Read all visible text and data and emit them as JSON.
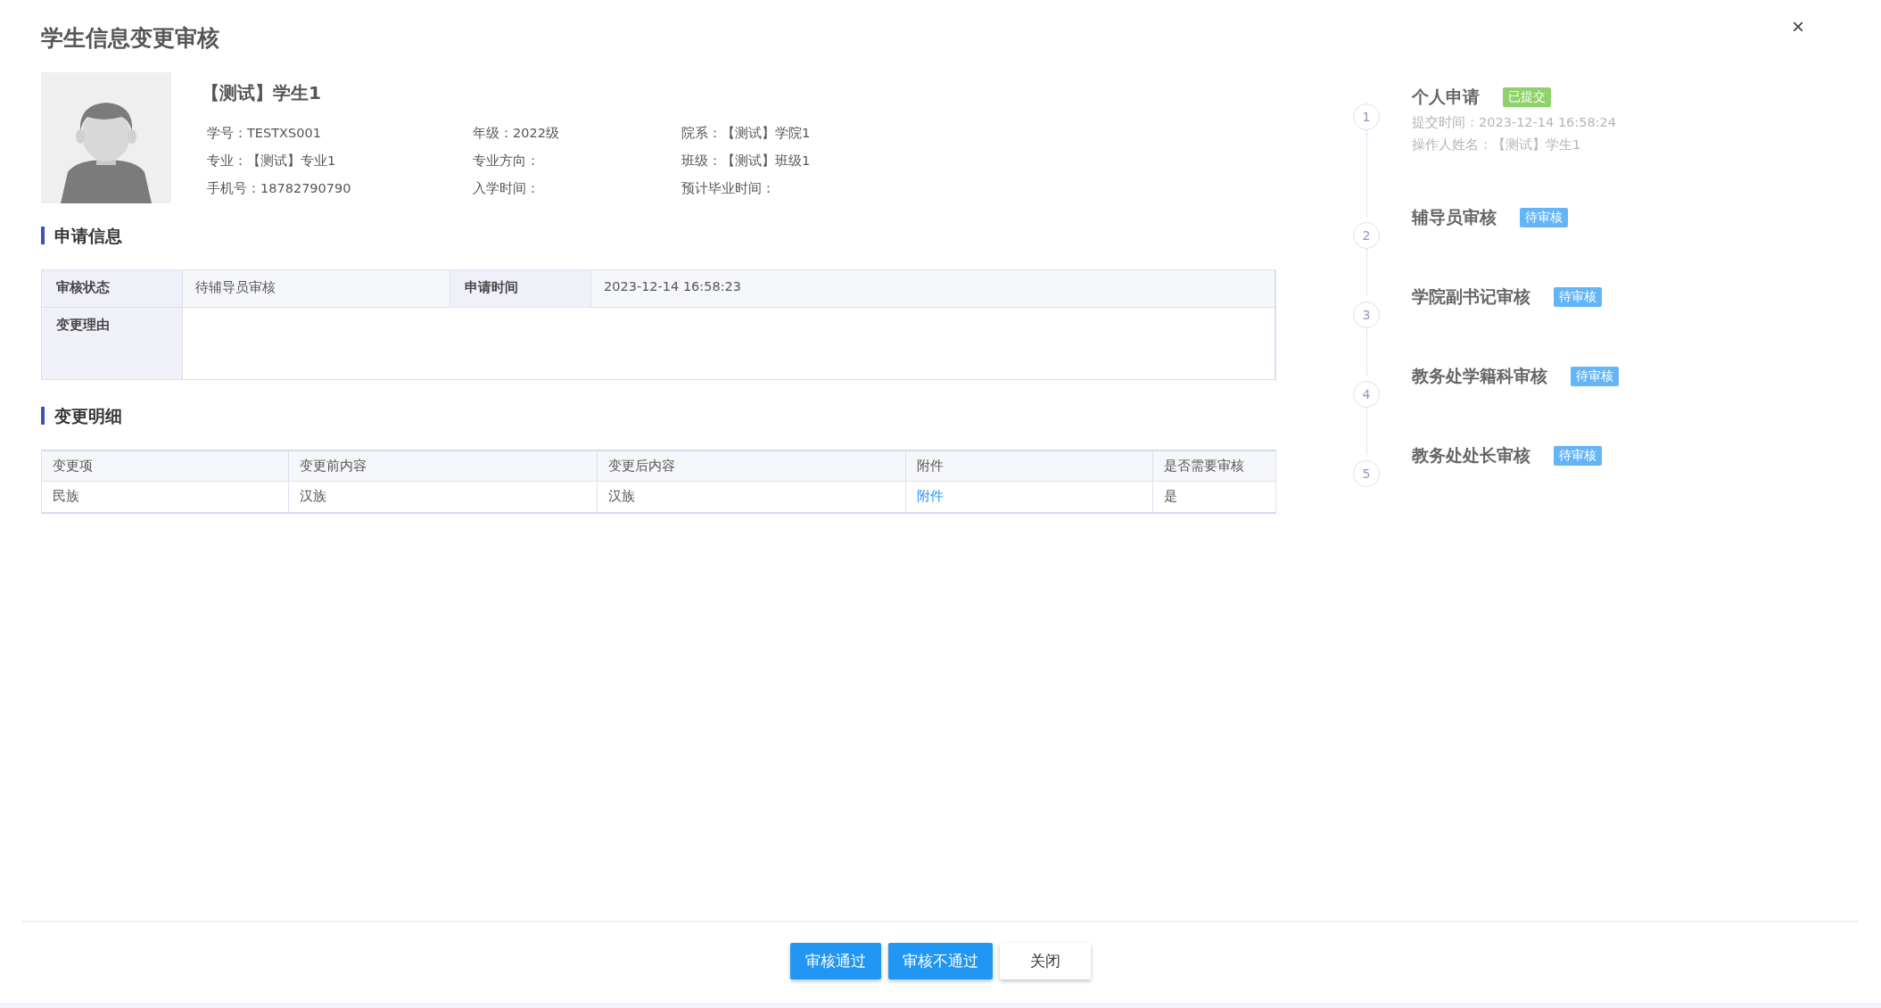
{
  "dialog": {
    "title": "学生信息变更审核",
    "close": "×"
  },
  "student": {
    "name": "【测试】学生1",
    "fields": [
      {
        "label": "学号：",
        "value": "TESTXS001"
      },
      {
        "label": "年级：",
        "value": "2022级"
      },
      {
        "label": "院系：",
        "value": "【测试】学院1"
      },
      {
        "label": "专业：",
        "value": "【测试】专业1"
      },
      {
        "label": "专业方向："
      },
      {
        "label": "班级：",
        "value": "【测试】班级1"
      },
      {
        "label": "手机号：",
        "value": "18782790790"
      },
      {
        "label": "入学时间："
      },
      {
        "label": "预计毕业时间："
      }
    ]
  },
  "application": {
    "heading": "申请信息",
    "status_label": "审核状态",
    "status_value": "待辅导员审核",
    "time_label": "申请时间",
    "time_value": "2023-12-14 16:58:23",
    "reason_label": "变更理由"
  },
  "changes": {
    "heading": "变更明细",
    "columns": [
      "变更项",
      "变更前内容",
      "变更后内容",
      "附件",
      "是否需要审核"
    ],
    "rows": [
      {
        "item": "民族",
        "before": "汉族",
        "after": "汉族",
        "attachment": "附件",
        "needs_review": "是"
      }
    ]
  },
  "timeline": [
    {
      "number": "1",
      "title": "个人申请",
      "kind": "submitted",
      "badge": "已提交",
      "details": [
        "提交时间：2023-12-14 16:58:24",
        "操作人姓名：【测试】学生1"
      ]
    },
    {
      "number": "2",
      "title": "辅导员审核",
      "kind": "pending",
      "badge": "待审核"
    },
    {
      "number": "3",
      "title": "学院副书记审核",
      "kind": "pending",
      "badge": "待审核"
    },
    {
      "number": "4",
      "title": "教务处学籍科审核",
      "kind": "pending",
      "badge": "待审核"
    },
    {
      "number": "5",
      "title": "教务处处长审核",
      "kind": "pending",
      "badge": "待审核"
    }
  ],
  "buttons": [
    {
      "label": "审核通过",
      "kind": "primary"
    },
    {
      "label": "审核不通过",
      "kind": "primary"
    },
    {
      "label": "关闭",
      "kind": "default"
    }
  ]
}
